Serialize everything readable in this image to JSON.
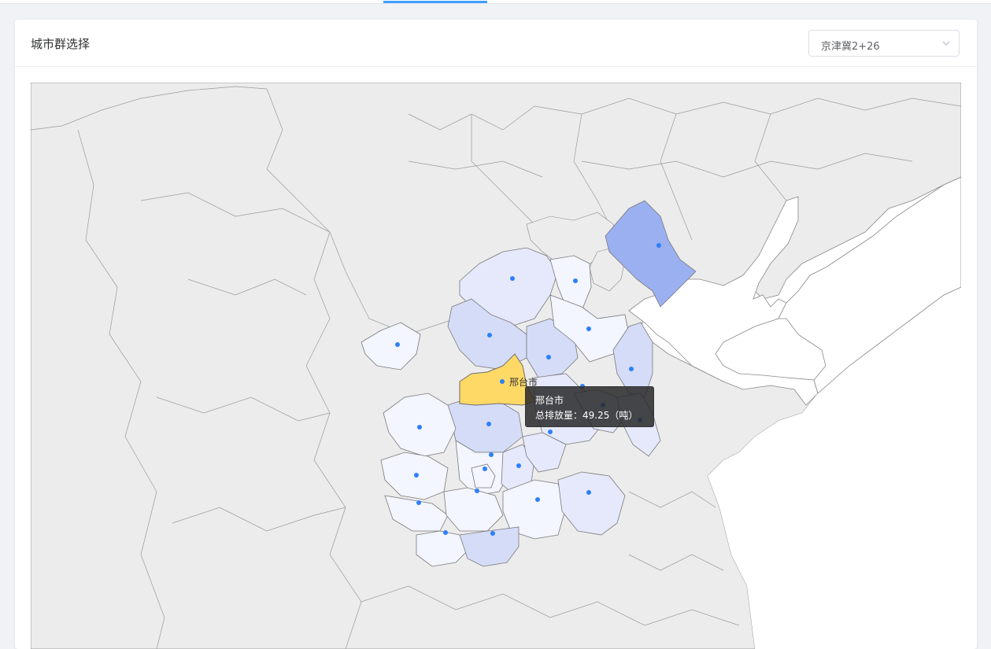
{
  "card": {
    "title": "城市群选择"
  },
  "select": {
    "value": "京津冀2+26"
  },
  "map": {
    "hover_label": "邢台市",
    "highlight_color": "#ffd966",
    "sea_color": "#ffffff",
    "land_color": "#ececec",
    "border_color": "#888888",
    "dot_color": "#2d7ff9",
    "choropleth_scale": [
      "#f3f5ff",
      "#e5e9fb",
      "#d4dcf7",
      "#9bb0f0"
    ]
  },
  "tooltip": {
    "city": "邢台市",
    "label": "总排放量：49.25（吨）"
  }
}
